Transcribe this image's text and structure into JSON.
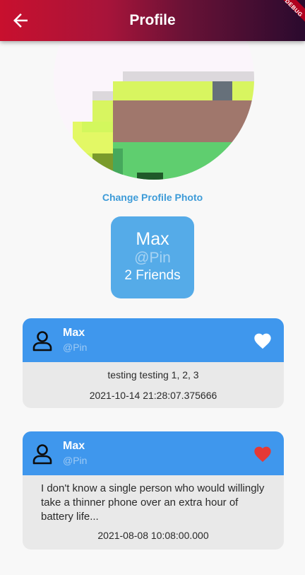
{
  "appbar": {
    "title": "Profile",
    "back_icon": "arrow-left-icon",
    "debug_banner": "DEBUG"
  },
  "profile": {
    "change_photo_label": "Change Profile Photo",
    "name": "Max",
    "handle": "@Pin",
    "friends": "2 Friends"
  },
  "posts": [
    {
      "name": "Max",
      "handle": "@Pin",
      "text": "testing testing 1, 2, 3",
      "timestamp": "2021-10-14 21:28:07.375666",
      "liked": false,
      "heart_color": "#ffffff"
    },
    {
      "name": "Max",
      "handle": "@Pin",
      "text": "I don't know a single person who would willingly take a thinner phone over an extra hour of battery life...",
      "timestamp": "2021-08-08 10:08:00.000",
      "liked": true,
      "heart_color": "#e53935"
    }
  ],
  "colors": {
    "accent": "#3f97ed",
    "link": "#3d9bd8",
    "card": "#55abe8"
  }
}
